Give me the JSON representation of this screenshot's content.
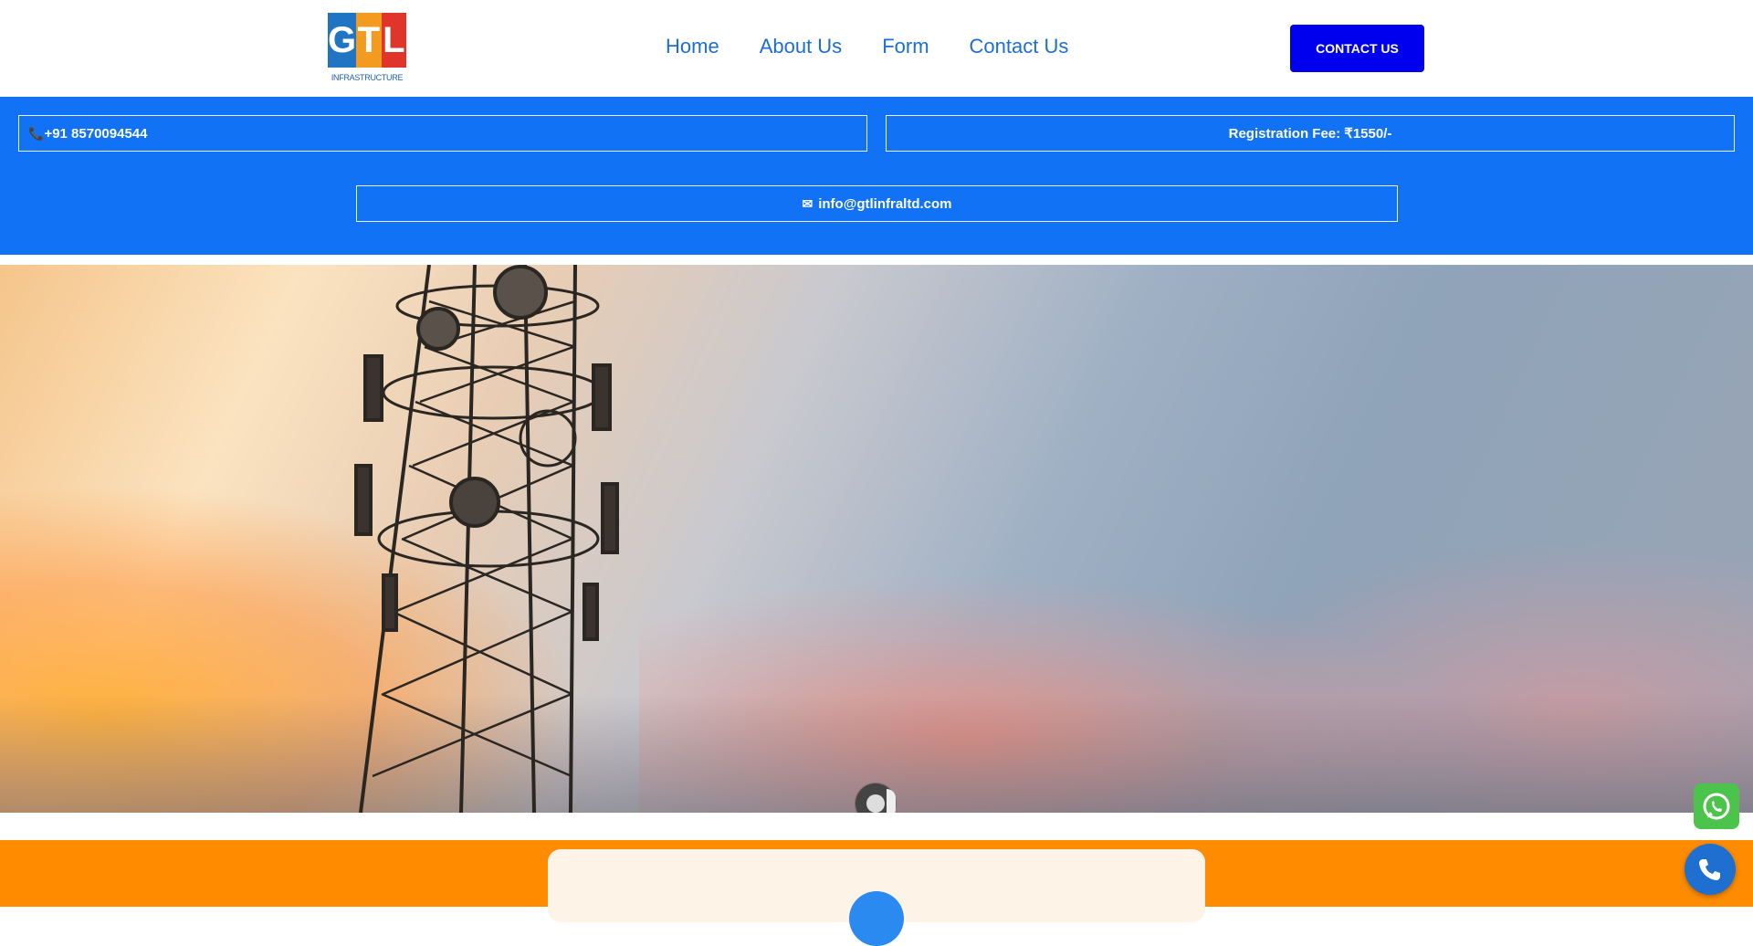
{
  "header": {
    "logo_letters": [
      "G",
      "T",
      "L"
    ],
    "logo_subtitle": "INFRASTRUCTURE",
    "nav": [
      {
        "label": "Home"
      },
      {
        "label": "About Us"
      },
      {
        "label": "Form"
      },
      {
        "label": "Contact Us"
      }
    ],
    "cta_label": "CONTACT US"
  },
  "info": {
    "phone": "+91 8570094544",
    "fee": "Registration Fee: ₹1550/-",
    "email": "info@gtlinfraltd.com",
    "phone_icon": "phone-icon",
    "email_icon": "email-icon"
  },
  "colors": {
    "primary_blue": "#1172f5",
    "cta_blue": "#0000ee",
    "nav_blue": "#1b6fd1",
    "orange": "#ff8c00",
    "whatsapp_green": "#4cc34b"
  },
  "floating": {
    "whatsapp_icon": "whatsapp-icon",
    "call_icon": "phone-call-icon"
  }
}
